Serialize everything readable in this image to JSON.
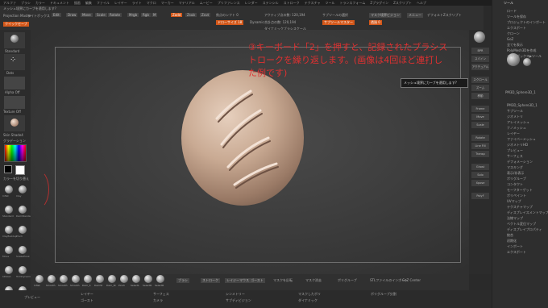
{
  "menu": {
    "items": [
      "アルファ",
      "ブラシ",
      "カラー",
      "ドキュメント",
      "描画",
      "編集",
      "ファイル",
      "レイヤー",
      "ライト",
      "マクロ",
      "マーカー",
      "マテリアル",
      "ムービー",
      "プリファレンス",
      "レンダー",
      "ステンシル",
      "ストローク",
      "テクスチャ",
      "ツール",
      "トランスフォーム",
      "Zプラグイン",
      "Zスクリプト",
      "ヘルプ"
    ]
  },
  "topbar": {
    "hint": "メッシュ境界にカーブを適用します?",
    "projection_master": "Projection Master",
    "lightbox": "ライトボックス",
    "edit_label": "Edit",
    "draw_label": "Draw",
    "move_label": "Move",
    "scale_label": "Scale",
    "rotate_label": "Rotate",
    "mrgb_label": "Mrgb",
    "rgb_label": "Rgb",
    "m_label": "M",
    "zadd_label": "Zadd",
    "zsub_label": "Zsub",
    "zcut_label": "Zcut",
    "focal_shift": "焦点のシフト 0",
    "draw_size": "ドローサイズ 18",
    "dynamic": "Dynamic",
    "active_points": "アクティブ点の数: 120,194",
    "total_points": "合計点の数: 120,194",
    "backface": "ダイナミックブラシスケール",
    "subtool_sel": "サブツールの選択",
    "subtool_master": "サブツールマスター",
    "mask_edge": "マスク境界ビジョン",
    "quick_save": "クイックセーブ",
    "see_through": "透過 0",
    "menus": "メニュー",
    "default_script": "デフォルトZスクリプト"
  },
  "left": {
    "standard": "Standard",
    "dots": "Dots",
    "alpha_off": "Alpha Off",
    "texture_off": "Texture Off",
    "material": "Skin Shade4",
    "gradient": "グラデーション",
    "switch_color": "カラーを切り替え",
    "brushes": [
      "Inflat",
      "Clay",
      "Standard",
      "DamStandard",
      "ClayBuildup",
      "Pinch",
      "Move",
      "SnakeHook",
      "hPolish",
      "TrimDynamic",
      "MaskLasso",
      "SelectRect"
    ],
    "edit_color": "#ff7a00",
    "main_color": "#ffffff"
  },
  "canvas": {
    "note": "③キーボード「2」を押すと、記録されたブラシストロークを繰り返します。(画像は4回ほど連打した例です)",
    "tooltip": "メッシュ境界にカーブを適用します?"
  },
  "rightbar": {
    "buttons": [
      "BPR",
      "スパイン",
      "アクチュアル",
      "スクロール",
      "ズーム",
      "移動",
      "Frame",
      "Move",
      "Scale",
      "Rotate",
      "Line Fill",
      "Transp",
      "Ghost",
      "Solo",
      "Xpose",
      "PolyF"
    ],
    "active": [
      "パースペクティブ",
      "ローカル",
      "フロア"
    ]
  },
  "tray": {
    "title": "ツール",
    "rows": [
      "ロード",
      "ツールを保存",
      "プロジェクトのインポート",
      "エクスポート",
      "クローン",
      "GoZ",
      "全てを表示",
      "PolyMesh3Dを作成",
      "ライトボックス▶ツール",
      "PM3D_Sphere3D_1",
      "サブツール",
      "ジオメトリ",
      "アレイメッシュ",
      "ナノメッシュ",
      "レイヤー",
      "ファイバーメッシュ",
      "ジオメトリHD",
      "プレビュー",
      "サーフェス",
      "デフォメーション",
      "マスキング",
      "表示/非表示",
      "ポリグループ",
      "コンタクト",
      "モーフターゲット",
      "ポリペイント",
      "UVマップ",
      "テクスチャマップ",
      "ディスプレイスメントマップ",
      "法線マップ",
      "ベクトル変位マップ",
      "ディスプレイプロパティ",
      "統合",
      "初期化",
      "インポート",
      "エクスポート"
    ],
    "subtool_name": "PM3D_Sphere3D_1"
  },
  "bottom": {
    "materials": [
      "Inflat",
      "Smooth",
      "Smooth",
      "Smooth"
    ],
    "brushes": [
      "Dam_S",
      "DamSt",
      "Dam_St",
      "Pinch"
    ],
    "selects": [
      "SelectL",
      "SelectR",
      "SelectR"
    ],
    "right_labels": [
      "ブラシ",
      "ストローク",
      "レイジーマウス",
      "ゴースト"
    ],
    "misc": [
      "マスクを反転",
      "マスク消去",
      "ポリグループ",
      "STLファイルのインポート",
      "GoZ Center"
    ]
  },
  "status": {
    "preview": "プレビュー",
    "items": [
      "レイヤー",
      "サーフェス",
      "シンメトリー",
      "マスクしたポリ",
      "ポリグループ分割",
      "ゴースト",
      "カメラ",
      "サブディビジョン",
      "ダイナミック"
    ]
  }
}
